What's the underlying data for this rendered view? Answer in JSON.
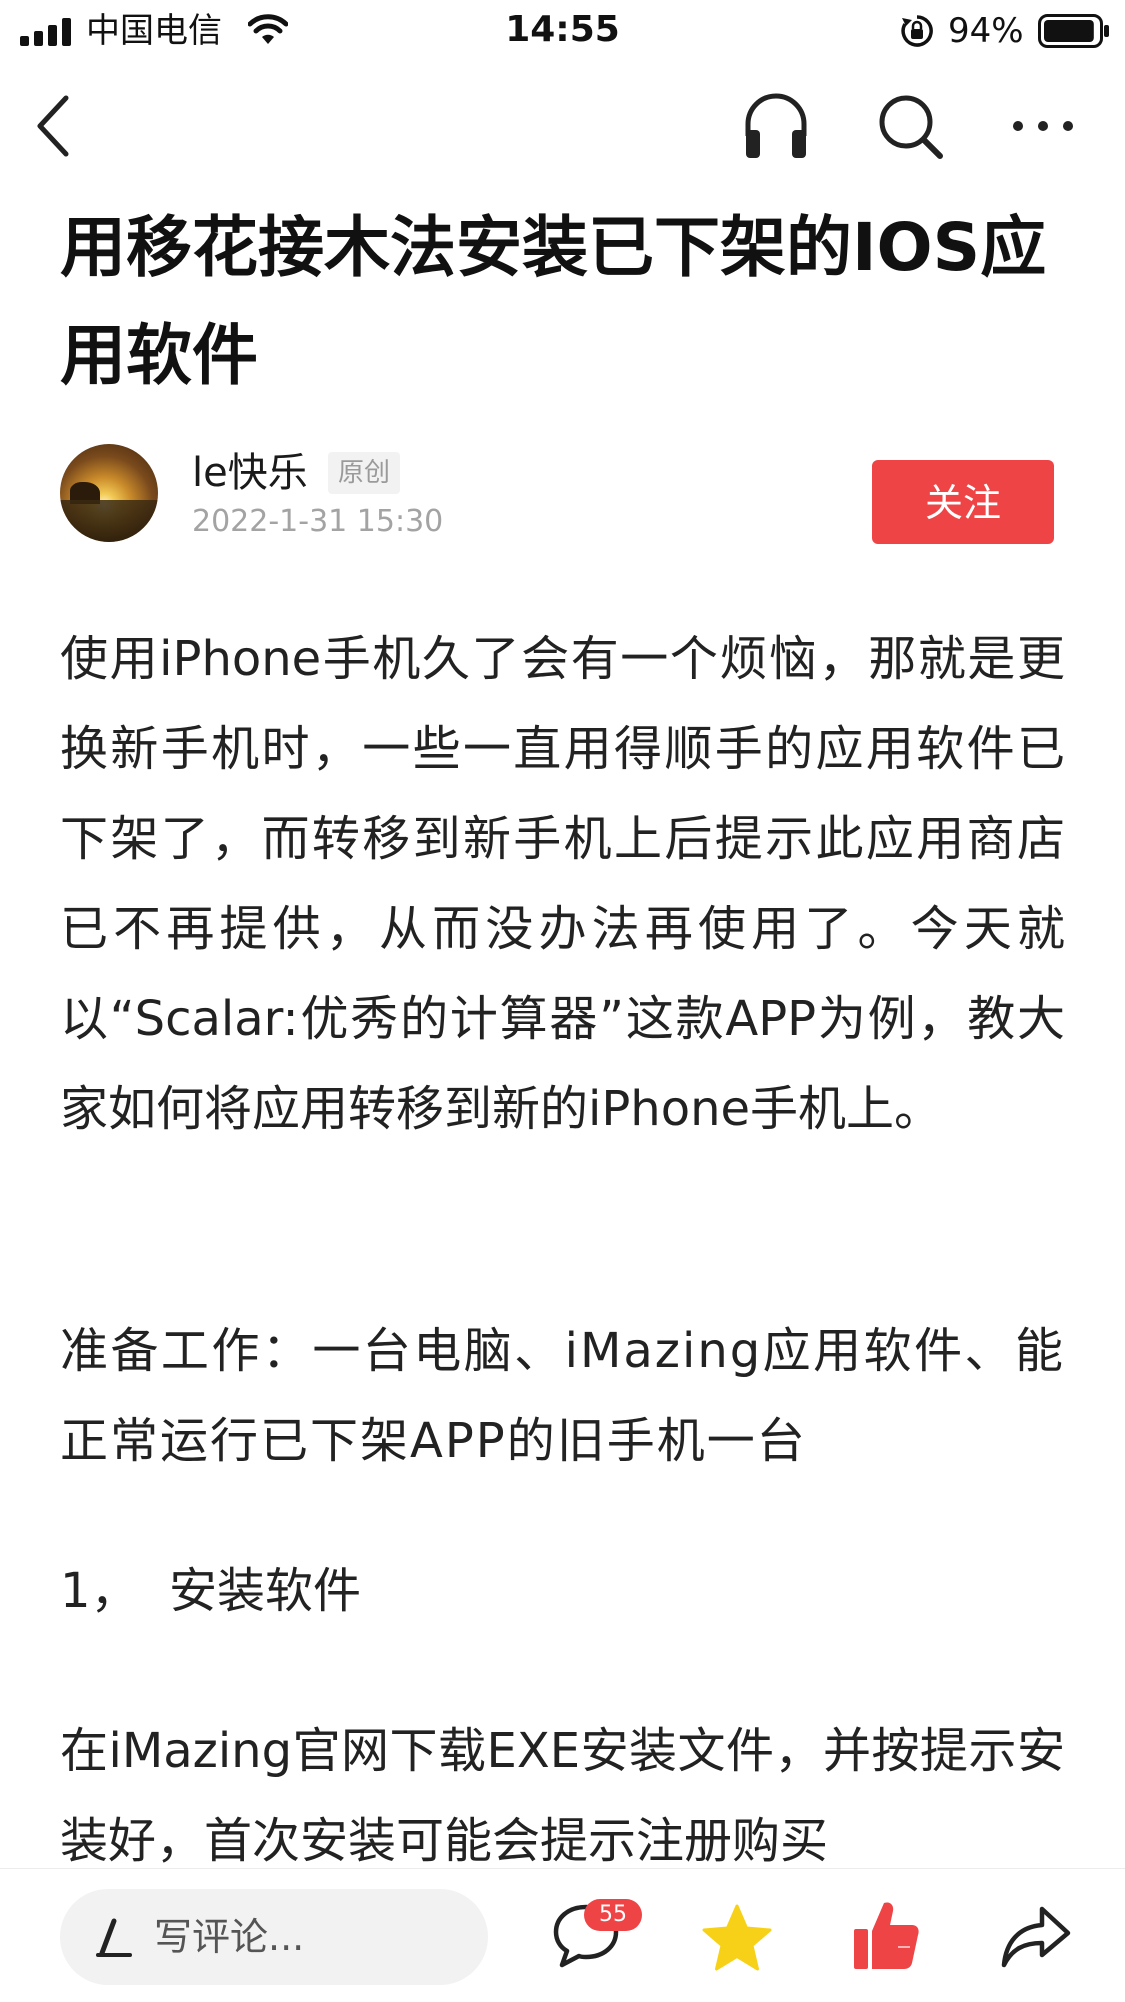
{
  "status_bar": {
    "carrier": "中国电信",
    "time": "14:55",
    "battery_percent": "94%",
    "battery_level": 0.94,
    "icons": [
      "signal-icon",
      "wifi-icon",
      "rotation-lock-icon",
      "battery-icon"
    ]
  },
  "nav_bar": {
    "icons": [
      "back-icon",
      "headphones-icon",
      "search-icon",
      "more-icon"
    ]
  },
  "article": {
    "title": "用移花接木法安装已下架的IOS应用软件",
    "author": {
      "name": "le快乐",
      "badge": "原创",
      "time": "2022-1-31 15:30",
      "follow_label": "关注"
    },
    "paragraphs": [
      "使用iPhone手机久了会有一个烦恼，那就是更换新手机时，一些一直用得顺手的应用软件已下架了，而转移到新手机上后提示此应用商店已不再提供，从而没办法再使用了。今天就以“Scalar:优秀的计算器”这款APP为例，教大家如何将应用转移到新的iPhone手机上。",
      "准备工作：一台电脑、iMazing应用软件、能正常运行已下架APP的旧手机一台",
      "1，  安装软件",
      "在iMazing官网下载EXE安装文件，并按提示安装好，首次安装可能会提示注册购买"
    ]
  },
  "bottom_bar": {
    "comment_placeholder": "写评论...",
    "comment_count": "55",
    "icons": [
      "pen-icon",
      "comment-icon",
      "favorite-star-icon",
      "like-icon",
      "share-icon"
    ],
    "colors": {
      "star": "#f7d117",
      "like": "#ef4446",
      "badge": "#ef4446",
      "follow": "#ef4446"
    }
  }
}
